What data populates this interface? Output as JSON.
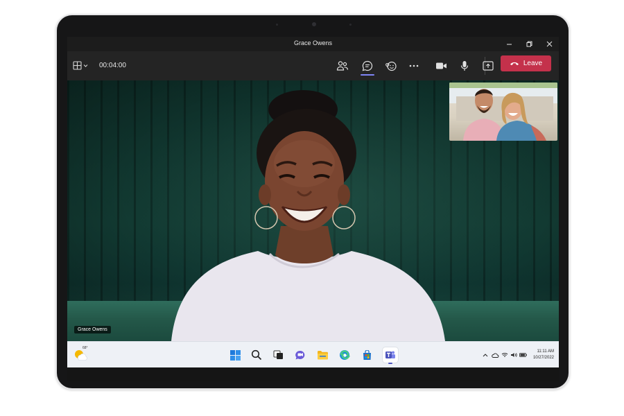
{
  "window": {
    "title": "Grace Owens"
  },
  "window_controls": {
    "minimize_icon": "minimize-icon",
    "restore_icon": "restore-icon",
    "close_icon": "close-icon"
  },
  "toolbar": {
    "layout_icon": "grid-layout-icon",
    "timer": "00:04:00",
    "items": [
      "people-icon",
      "chat-icon",
      "reactions-icon",
      "more-icon",
      "camera-icon",
      "mic-icon",
      "share-icon"
    ],
    "active_item": "chat-icon",
    "leave_label": "Leave",
    "leave_color": "#c4314b",
    "accent_color": "#7f85f5"
  },
  "main_video": {
    "participant_name": "Grace Owens"
  },
  "taskbar": {
    "weather_temp": "68°",
    "apps": [
      "windows-start-icon",
      "search-icon",
      "task-view-icon",
      "chat-icon",
      "file-explorer-icon",
      "edge-icon",
      "store-icon",
      "teams-icon"
    ],
    "active_app": "teams-icon",
    "tray_icons": [
      "chevron-up-icon",
      "cloud-icon",
      "wifi-icon",
      "volume-icon",
      "battery-icon"
    ],
    "time": "11:11 AM",
    "date": "10/27/2022"
  }
}
